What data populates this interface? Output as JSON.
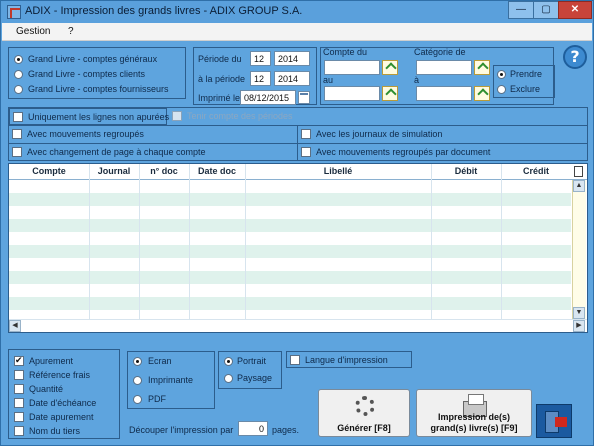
{
  "window": {
    "title": "ADIX - Impression des grands livres - ADIX GROUP S.A.",
    "minimize": "—",
    "maximize": "▢",
    "close": "✕"
  },
  "menu": [
    "Gestion",
    "?"
  ],
  "ledger_type": {
    "options": [
      {
        "label": "Grand Livre - comptes généraux",
        "selected": true
      },
      {
        "label": "Grand Livre - comptes clients",
        "selected": false
      },
      {
        "label": "Grand Livre - comptes fournisseurs",
        "selected": false
      }
    ]
  },
  "period": {
    "from_label": "Période du",
    "from_month": "12",
    "from_year": "2014",
    "to_label": "à la période",
    "to_month": "12",
    "to_year": "2014",
    "printed_label": "Imprimé le",
    "printed_date": "08/12/2015"
  },
  "account": {
    "from_label": "Compte du",
    "from_value": "",
    "to_label": "au",
    "to_value": ""
  },
  "category": {
    "from_label": "Catégorie de",
    "from_value": "",
    "to_label": "à",
    "to_value": "",
    "include": {
      "label": "Prendre",
      "selected": true
    },
    "exclude": {
      "label": "Exclure",
      "selected": false
    }
  },
  "filters": {
    "unpaid_only": {
      "label": "Uniquement les lignes non apurées",
      "checked": false
    },
    "keep_periods": {
      "label": "Tenir compte des périodes",
      "checked": false,
      "disabled": true
    },
    "grouped_moves": {
      "label": "Avec mouvements regroupés",
      "checked": false
    },
    "simulation_journals": {
      "label": "Avec les journaux de simulation",
      "checked": false
    },
    "page_per_account": {
      "label": "Avec changement de page à chaque compte",
      "checked": false
    },
    "grouped_by_document": {
      "label": "Avec mouvements regroupés par document",
      "checked": false
    }
  },
  "grid": {
    "columns": [
      "Compte",
      "Journal",
      "n° doc",
      "Date doc",
      "Libellé",
      "Débit",
      "Crédit"
    ],
    "rows": 10
  },
  "print_options": {
    "items": [
      {
        "label": "Apurement",
        "checked": true
      },
      {
        "label": "Référence frais",
        "checked": false
      },
      {
        "label": "Quantité",
        "checked": false
      },
      {
        "label": "Date d'échéance",
        "checked": false
      },
      {
        "label": "Date apurement",
        "checked": false
      },
      {
        "label": "Nom du tiers",
        "checked": false
      }
    ]
  },
  "output": {
    "options": [
      {
        "label": "Ecran",
        "selected": true
      },
      {
        "label": "Imprimante",
        "selected": false
      },
      {
        "label": "PDF",
        "selected": false
      }
    ]
  },
  "orientation": {
    "options": [
      {
        "label": "Portrait",
        "selected": true
      },
      {
        "label": "Paysage",
        "selected": false
      }
    ]
  },
  "language": {
    "label": "Langue d'impression",
    "checked": false
  },
  "split": {
    "label_before": "Découper l'impression par",
    "value": "0",
    "label_after": "pages."
  },
  "buttons": {
    "generate": "Générer  [F8]",
    "print_line1": "Impression de(s)",
    "print_line2": "grand(s) livre(s)   [F9]"
  },
  "colors": {
    "panel_bg": "#5ea4de",
    "grid_alt_row": "#dff2ec",
    "close_red": "#c8443a"
  }
}
